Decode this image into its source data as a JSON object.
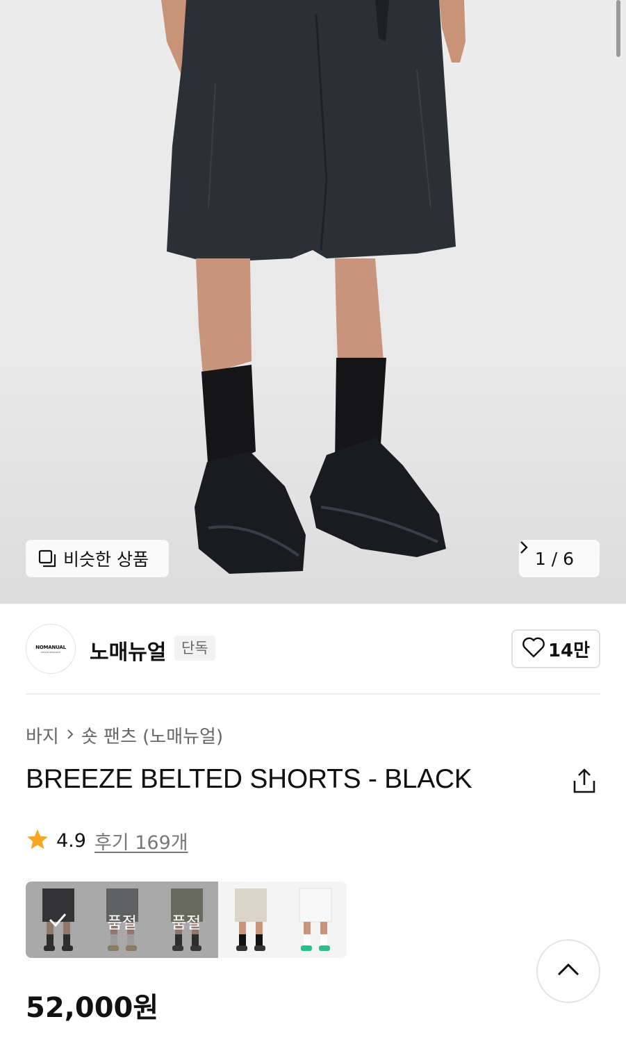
{
  "hero": {
    "similar_label": "비슷한 상품",
    "pager": {
      "current": "1",
      "separator": "/",
      "total": "6"
    }
  },
  "brand": {
    "logo_text": "NOMANUAL",
    "logo_sub": "DESIGN RESEARCH",
    "name": "노매뉴얼",
    "tag": "단독",
    "like_count": "14만"
  },
  "breadcrumb": {
    "category": "바지",
    "subcategory": "숏 팬츠 (노매뉴얼)"
  },
  "product": {
    "title": "BREEZE BELTED SHORTS - BLACK",
    "rating": "4.9",
    "reviews_label": "후기 169개",
    "price": "52,000원"
  },
  "swatches": [
    {
      "color": "black",
      "selected": true,
      "soldout": false,
      "soldout_label": ""
    },
    {
      "color": "gray",
      "selected": false,
      "soldout": true,
      "soldout_label": "품절"
    },
    {
      "color": "khaki",
      "selected": false,
      "soldout": true,
      "soldout_label": "품절"
    },
    {
      "color": "beige",
      "selected": false,
      "soldout": false,
      "soldout_label": ""
    },
    {
      "color": "white",
      "selected": false,
      "soldout": false,
      "soldout_label": ""
    }
  ],
  "colors": {
    "star": "#f5a623",
    "text": "#111111",
    "muted": "#666666"
  }
}
